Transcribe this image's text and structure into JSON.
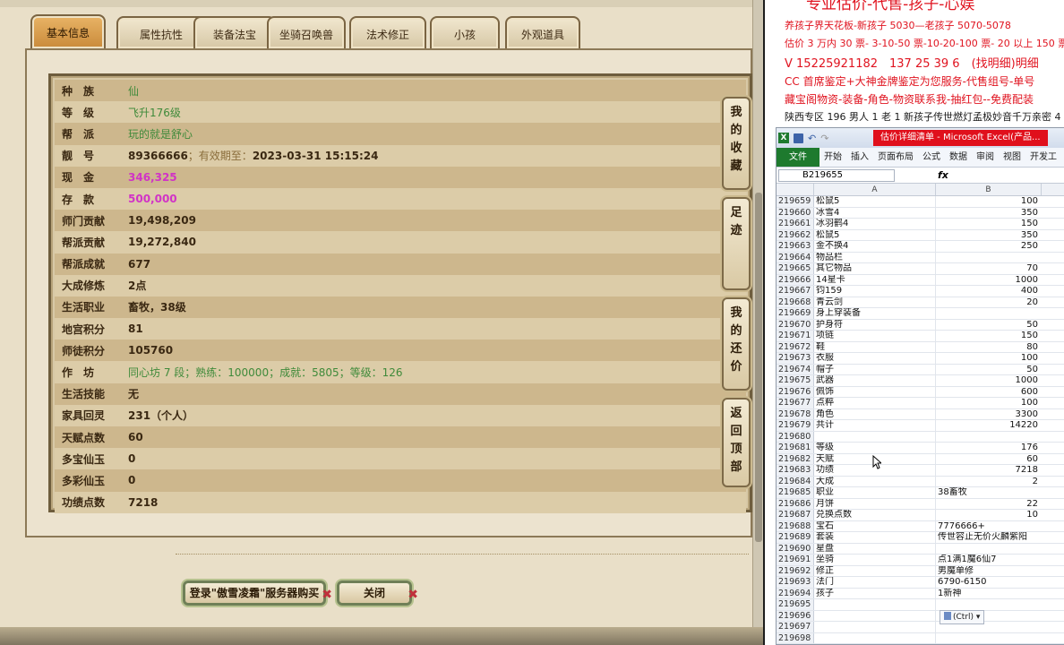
{
  "game": {
    "tabs": [
      "基本信息",
      "属性抗性",
      "装备法宝",
      "坐骑召唤兽",
      "法术修正",
      "小孩",
      "外观道具"
    ],
    "active_tab": 0,
    "rows": [
      {
        "label": "种　族",
        "value": "仙",
        "style": "green"
      },
      {
        "label": "等　级",
        "value": "飞升176级",
        "style": "green"
      },
      {
        "label": "帮　派",
        "value": "玩的就是舒心",
        "style": "green"
      },
      {
        "label": "靓　号",
        "value": "89366666",
        "sub": "；有效期至：",
        "extra": "2023-03-31 15:15:24",
        "style": "bold"
      },
      {
        "label": "现　金",
        "value": "346,325",
        "style": "pink"
      },
      {
        "label": "存　款",
        "value": "500,000",
        "style": "pink"
      },
      {
        "label": "师门贡献",
        "value": "19,498,209",
        "style": "bold"
      },
      {
        "label": "帮派贡献",
        "value": "19,272,840",
        "style": "bold"
      },
      {
        "label": "帮派成就",
        "value": "677",
        "style": "bold"
      },
      {
        "label": "大成修炼",
        "value": "2点",
        "style": "bold"
      },
      {
        "label": "生活职业",
        "value": "畜牧，38级",
        "style": "bold"
      },
      {
        "label": "地宫积分",
        "value": "81",
        "style": "bold"
      },
      {
        "label": "师徒积分",
        "value": "105760",
        "style": "bold"
      },
      {
        "label": "作　坊",
        "value": "同心坊 7 段；熟练：100000；成就：5805；等级：126",
        "style": "green"
      },
      {
        "label": "生活技能",
        "value": "无",
        "style": "bold"
      },
      {
        "label": "家具回灵",
        "value": "231（个人）",
        "style": "bold"
      },
      {
        "label": "天赋点数",
        "value": "60",
        "style": "bold"
      },
      {
        "label": "多宝仙玉",
        "value": "0",
        "style": "bold"
      },
      {
        "label": "多彩仙玉",
        "value": "0",
        "style": "bold"
      },
      {
        "label": "功绩点数",
        "value": "7218",
        "style": "bold"
      }
    ],
    "side_buttons": [
      {
        "label": "我的收藏",
        "name": "favorites-button"
      },
      {
        "label": "足迹",
        "name": "footprint-button"
      },
      {
        "label": "我的还价",
        "name": "my-offers-button"
      },
      {
        "label": "返回顶部",
        "name": "back-to-top-button"
      }
    ],
    "login_button": "登录\"傲雪凌霜\"服务器购买",
    "close_button": "关闭",
    "close_mark": "✖"
  },
  "ad": {
    "line0": "专业估价-代售-孩子-心娱",
    "line1": "养孩子界天花板-新孩子 5030—老孩子 5070-5078",
    "line2": "估价 3 万内 30 票- 3-10-50 票-10-20-100 票- 20 以上 150 票-1 票",
    "line3": "V 15225921182　137 25 39 6　(找明细)明细",
    "line4": "CC 首席鉴定+大神金牌鉴定为您服务-代售组号-单号",
    "line5": "藏宝阁物资-装备-角色-物资联系我-抽红包--免费配装",
    "line6": "陕西专区 196 男人 1 老 1 新孩子传世燃灯孟极妙音千万亲密 4"
  },
  "excel": {
    "title": "估价详细清单 - Microsoft Excel(产品...",
    "ribbon_file": "文件",
    "ribbon_tabs": [
      "开始",
      "插入",
      "页面布局",
      "公式",
      "数据",
      "审阅",
      "视图",
      "开发工"
    ],
    "name_box": "B219655",
    "fx": "fx",
    "col_a": "A",
    "col_b": "B",
    "paste_options": "(Ctrl)",
    "rows": [
      {
        "n": "219659",
        "a": "松鼠5",
        "b": "100"
      },
      {
        "n": "219660",
        "a": "冰雪4",
        "b": "350"
      },
      {
        "n": "219661",
        "a": "冰羽鹤4",
        "b": "150"
      },
      {
        "n": "219662",
        "a": "松鼠5",
        "b": "350"
      },
      {
        "n": "219663",
        "a": "金不换4",
        "b": "250"
      },
      {
        "n": "219664",
        "a": "物品栏",
        "b": ""
      },
      {
        "n": "219665",
        "a": "其它物品",
        "b": "70"
      },
      {
        "n": "219666",
        "a": "14星卡",
        "b": "1000"
      },
      {
        "n": "219667",
        "a": "钧159",
        "b": "400"
      },
      {
        "n": "219668",
        "a": "青云剑",
        "b": "20"
      },
      {
        "n": "219669",
        "a": "身上穿装备",
        "b": ""
      },
      {
        "n": "219670",
        "a": "护身符",
        "b": "50"
      },
      {
        "n": "219671",
        "a": "项链",
        "b": "150"
      },
      {
        "n": "219672",
        "a": "鞋",
        "b": "80"
      },
      {
        "n": "219673",
        "a": "衣服",
        "b": "100"
      },
      {
        "n": "219674",
        "a": "帽子",
        "b": "50"
      },
      {
        "n": "219675",
        "a": "武器",
        "b": "1000"
      },
      {
        "n": "219676",
        "a": "佩饰",
        "b": "600"
      },
      {
        "n": "219677",
        "a": "点粹",
        "b": "100"
      },
      {
        "n": "219678",
        "a": "角色",
        "b": "3300"
      },
      {
        "n": "219679",
        "a": "共计",
        "b": "14220"
      },
      {
        "n": "219680",
        "a": "",
        "b": ""
      },
      {
        "n": "219681",
        "a": "等级",
        "b": "176"
      },
      {
        "n": "219682",
        "a": "天赋",
        "b": "60"
      },
      {
        "n": "219683",
        "a": "功绩",
        "b": "7218"
      },
      {
        "n": "219684",
        "a": "大成",
        "b": "2"
      },
      {
        "n": "219685",
        "a": "职业",
        "b": "38畜牧"
      },
      {
        "n": "219686",
        "a": "月饼",
        "b": "22"
      },
      {
        "n": "219687",
        "a": "兑换点数",
        "b": "10"
      },
      {
        "n": "219688",
        "a": "宝石",
        "b": "7776666+"
      },
      {
        "n": "219689",
        "a": "套装",
        "b": "传世容止无价火麟紫阳"
      },
      {
        "n": "219690",
        "a": "星盘",
        "b": ""
      },
      {
        "n": "219691",
        "a": "坐骑",
        "b": "点1满1魔6仙7"
      },
      {
        "n": "219692",
        "a": "修正",
        "b": "男魔单修"
      },
      {
        "n": "219693",
        "a": "法门",
        "b": "6790-6150"
      },
      {
        "n": "219694",
        "a": "孩子",
        "b": "1新神"
      },
      {
        "n": "219695",
        "a": "",
        "b": ""
      },
      {
        "n": "219696",
        "a": "",
        "b": ""
      },
      {
        "n": "219697",
        "a": "",
        "b": ""
      },
      {
        "n": "219698",
        "a": "",
        "b": ""
      }
    ]
  }
}
